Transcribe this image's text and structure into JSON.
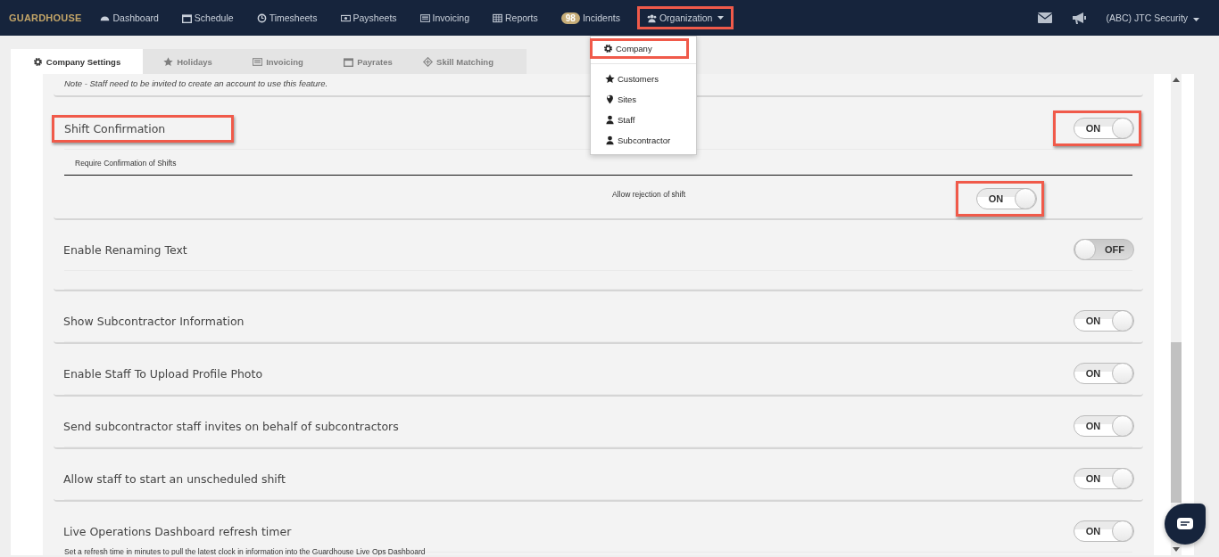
{
  "brand": "GUARDHOUSE",
  "nav": [
    {
      "label": "Dashboard",
      "highlighted": false
    },
    {
      "label": "Schedule",
      "highlighted": false
    },
    {
      "label": "Timesheets",
      "highlighted": false
    },
    {
      "label": "Paysheets",
      "highlighted": false
    },
    {
      "label": "Invoicing",
      "highlighted": false
    },
    {
      "label": "Reports",
      "highlighted": false
    },
    {
      "label": "Incidents",
      "badge": "98",
      "highlighted": false
    },
    {
      "label": "Organization",
      "dropdown": true,
      "highlighted": true
    }
  ],
  "account": "(ABC) JTC Security",
  "menu": [
    {
      "label": "Company",
      "highlighted": true,
      "divider_after": true
    },
    {
      "label": "Customers",
      "highlighted": false,
      "divider_after": false
    },
    {
      "label": "Sites",
      "highlighted": false,
      "divider_after": false
    },
    {
      "label": "Staff",
      "highlighted": false,
      "divider_after": false
    },
    {
      "label": "Subcontractor",
      "highlighted": false,
      "divider_after": false
    }
  ],
  "tabs": [
    {
      "label": "Company Settings",
      "selected": true
    },
    {
      "label": "Holidays",
      "selected": false
    },
    {
      "label": "Invoicing",
      "selected": false
    },
    {
      "label": "Payrates",
      "selected": false
    },
    {
      "label": "Skill Matching",
      "selected": false
    }
  ],
  "note": "Note - Staff need to be invited to create an account to use this feature.",
  "settings": [
    {
      "title": "Shift Confirmation",
      "highlighted": true,
      "toggle": {
        "on": true,
        "label": "ON",
        "highlighted": true
      },
      "subtitle": "Require Confirmation of Shifts",
      "suboption": {
        "label": "Allow rejection of shift",
        "toggle": {
          "on": true,
          "label": "ON",
          "highlighted": true
        }
      }
    },
    {
      "title": "Enable Renaming Text",
      "highlighted": false,
      "toggle": {
        "on": false,
        "label": "OFF",
        "highlighted": false
      },
      "spacer": true
    },
    {
      "title": "Show Subcontractor Information",
      "highlighted": false,
      "toggle": {
        "on": true,
        "label": "ON",
        "highlighted": false
      }
    },
    {
      "title": "Enable Staff To Upload Profile Photo",
      "highlighted": false,
      "toggle": {
        "on": true,
        "label": "ON",
        "highlighted": false
      }
    },
    {
      "title": "Send subcontractor staff invites on behalf of subcontractors",
      "highlighted": false,
      "toggle": {
        "on": true,
        "label": "ON",
        "highlighted": false
      }
    },
    {
      "title": "Allow staff to start an unscheduled shift",
      "highlighted": false,
      "toggle": {
        "on": true,
        "label": "ON",
        "highlighted": false
      }
    },
    {
      "title": "Live Operations Dashboard refresh timer",
      "highlighted": false,
      "toggle": {
        "on": true,
        "label": "ON",
        "highlighted": false
      },
      "description": "Set a refresh time in minutes to pull the latest clock in information into the Guardhouse Live Ops Dashboard"
    }
  ]
}
